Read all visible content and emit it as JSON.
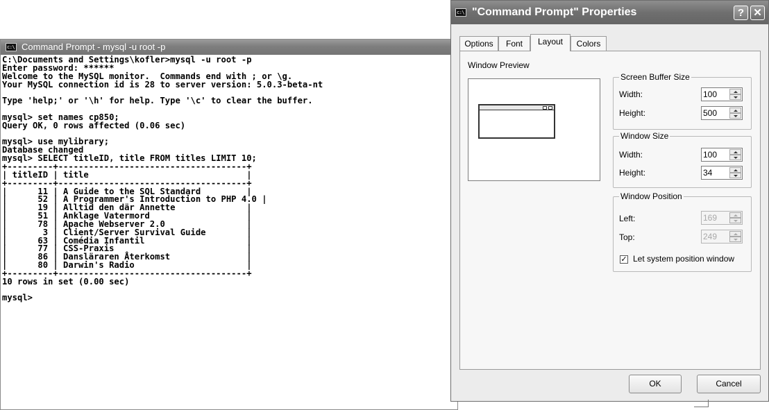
{
  "console": {
    "title": "Command Prompt - mysql -u root -p",
    "icon": "cmd-icon",
    "text": "C:\\Documents and Settings\\kofler>mysql -u root -p\nEnter password: ******\nWelcome to the MySQL monitor.  Commands end with ; or \\g.\nYour MySQL connection id is 28 to server version: 5.0.3-beta-nt\n\nType 'help;' or '\\h' for help. Type '\\c' to clear the buffer.\n\nmysql> set names cp850;\nQuery OK, 0 rows affected (0.06 sec)\n\nmysql> use mylibrary;\nDatabase changed\nmysql> SELECT titleID, title FROM titles LIMIT 10;\n+---------+-------------------------------------+\n| titleID | title                               |\n+---------+-------------------------------------+\n|      11 | A Guide to the SQL Standard         |\n|      52 | A Programmer's Introduction to PHP 4.0 |\n|      19 | Alltid den där Annette              |\n|      51 | Anklage Vatermord                   |\n|      78 | Apache Webserver 2.0                |\n|       3 | Client/Server Survival Guide        |\n|      63 | Comédia Infantil                    |\n|      77 | CSS-Praxis                          |\n|      86 | Dansläraren Återkomst               |\n|      80 | Darwin's Radio                      |\n+---------+-------------------------------------+\n10 rows in set (0.00 sec)\n\nmysql>"
  },
  "dialog": {
    "title": "\"Command Prompt\" Properties",
    "help_glyph": "?",
    "close_glyph": "✕",
    "tabs": [
      {
        "label": "Options",
        "active": false
      },
      {
        "label": "Font",
        "active": false
      },
      {
        "label": "Layout",
        "active": true
      },
      {
        "label": "Colors",
        "active": false
      }
    ],
    "window_preview_label": "Window Preview",
    "screen_buffer": {
      "title": "Screen Buffer Size",
      "width_label": "Width:",
      "width": "100",
      "height_label": "Height:",
      "height": "500"
    },
    "window_size": {
      "title": "Window Size",
      "width_label": "Width:",
      "width": "100",
      "height_label": "Height:",
      "height": "34"
    },
    "window_position": {
      "title": "Window Position",
      "left_label": "Left:",
      "left": "169",
      "top_label": "Top:",
      "top": "249",
      "checkbox_label": "Let system position window",
      "checkbox_mark": "✓",
      "checked": true
    },
    "ok_label": "OK",
    "cancel_label": "Cancel"
  }
}
